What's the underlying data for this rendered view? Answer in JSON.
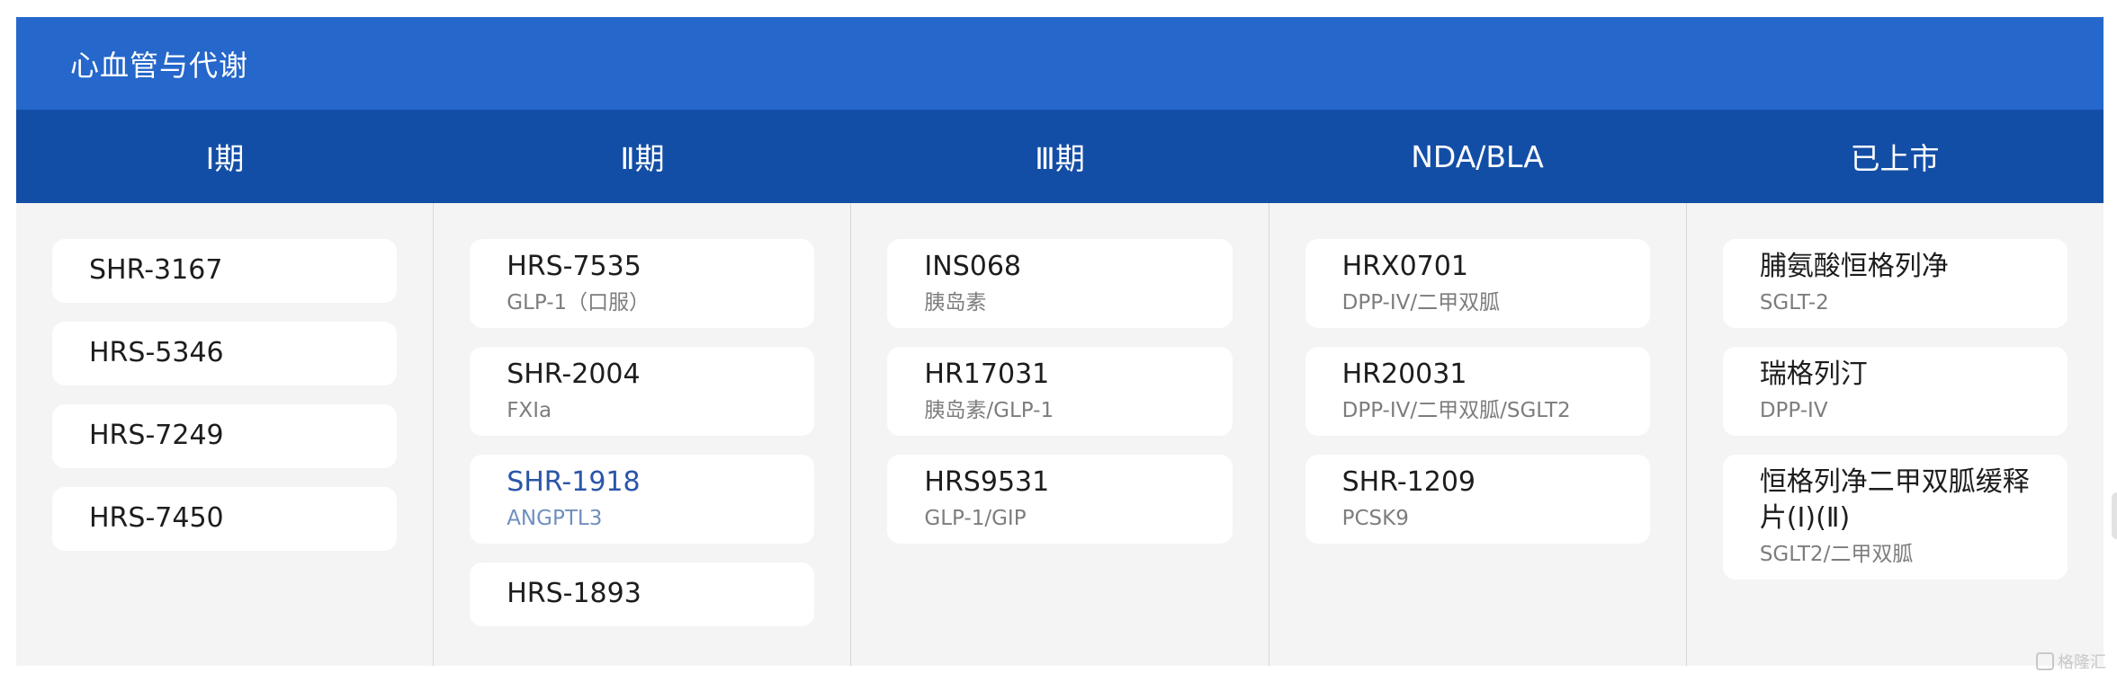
{
  "section": {
    "title": "心血管与代谢"
  },
  "phases": [
    "Ⅰ期",
    "Ⅱ期",
    "Ⅲ期",
    "NDA/BLA",
    "已上市"
  ],
  "columns": [
    {
      "cards": [
        {
          "name": "SHR-3167",
          "sub": ""
        },
        {
          "name": "HRS-5346",
          "sub": ""
        },
        {
          "name": "HRS-7249",
          "sub": ""
        },
        {
          "name": "HRS-7450",
          "sub": ""
        }
      ]
    },
    {
      "cards": [
        {
          "name": "HRS-7535",
          "sub": "GLP-1（口服）"
        },
        {
          "name": "SHR-2004",
          "sub": "FXIa"
        },
        {
          "name": "SHR-1918",
          "sub": "ANGPTL3",
          "highlight": true
        },
        {
          "name": "HRS-1893",
          "sub": ""
        }
      ]
    },
    {
      "cards": [
        {
          "name": "INS068",
          "sub": "胰岛素"
        },
        {
          "name": "HR17031",
          "sub": "胰岛素/GLP-1"
        },
        {
          "name": "HRS9531",
          "sub": "GLP-1/GIP"
        }
      ]
    },
    {
      "cards": [
        {
          "name": "HRX0701",
          "sub": "DPP-IV/二甲双胍"
        },
        {
          "name": "HR20031",
          "sub": "DPP-IV/二甲双胍/SGLT2"
        },
        {
          "name": "SHR-1209",
          "sub": "PCSK9"
        }
      ]
    },
    {
      "cards": [
        {
          "name": "脯氨酸恒格列净",
          "sub": "SGLT-2"
        },
        {
          "name": "瑞格列汀",
          "sub": "DPP-IV"
        },
        {
          "name": "恒格列净二甲双胍缓释片(Ⅰ)(Ⅱ)",
          "sub": "SGLT2/二甲双胍"
        }
      ]
    }
  ],
  "watermark": {
    "text": "格隆汇"
  },
  "colors": {
    "title_bar": "#2567cb",
    "phase_bar": "#134ea6",
    "highlight_text": "#2a56a8"
  }
}
